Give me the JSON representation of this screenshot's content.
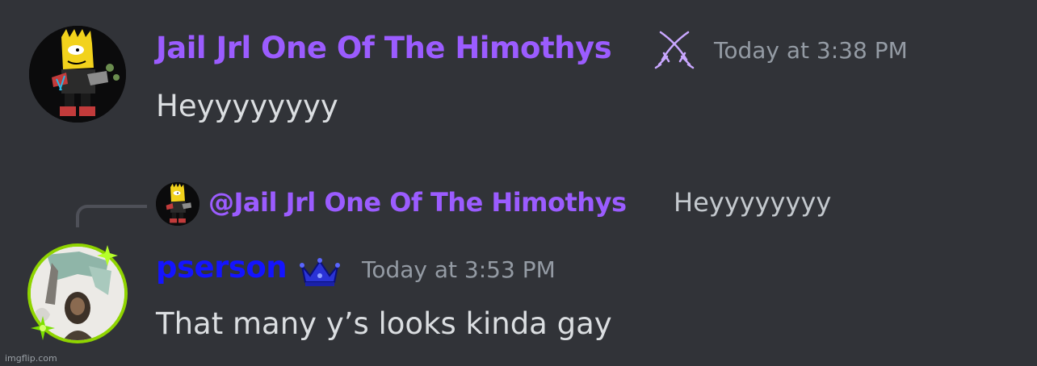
{
  "colors": {
    "background": "#313338",
    "author1_name": "#9b5cff",
    "author2_name": "#1414ff",
    "timestamp": "#949ba4",
    "message_text": "#dbdee1",
    "avatar_ring": "#8fd400"
  },
  "messages": [
    {
      "author": "Jail Jrl One Of The Himothys",
      "badge_icon": "crossed-swords-icon",
      "timestamp": "Today at 3:38 PM",
      "content": "Heyyyyyyyy"
    },
    {
      "reply_to": {
        "mention": "@Jail Jrl One Of The Himothys",
        "snippet": "Heyyyyyyyy"
      },
      "author": "pserson",
      "badge_icon": "crown-icon",
      "timestamp": "Today at 3:53 PM",
      "content": "That many y’s looks kinda gay"
    }
  ],
  "watermark": "imgflip.com"
}
